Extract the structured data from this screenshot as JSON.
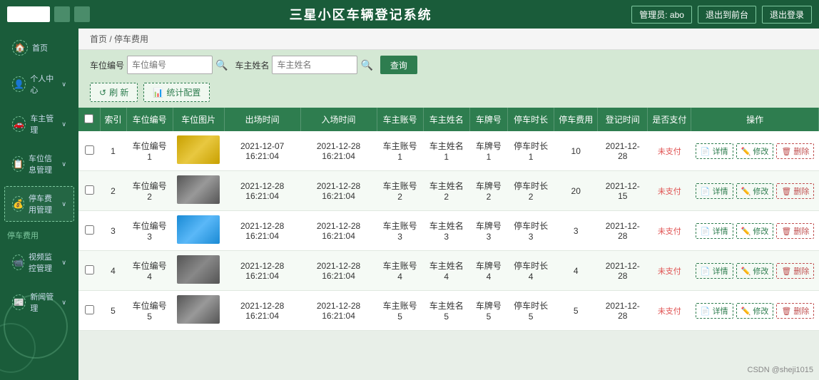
{
  "app": {
    "title": "三星小区车辆登记系统",
    "header": {
      "user_label": "管理员: abo",
      "btn_back": "退出到前台",
      "btn_logout": "退出登录"
    }
  },
  "sidebar": {
    "items": [
      {
        "id": "home",
        "label": "首页",
        "icon": "🏠",
        "arrow": ""
      },
      {
        "id": "personal",
        "label": "个人中心",
        "icon": "👤",
        "arrow": "∨"
      },
      {
        "id": "owner",
        "label": "车主管理",
        "icon": "🚗",
        "arrow": "∨"
      },
      {
        "id": "parking",
        "label": "车位信息管理",
        "icon": "📋",
        "arrow": "∨"
      },
      {
        "id": "parking-fee",
        "label": "停车费用管理",
        "icon": "💰",
        "arrow": "∨"
      }
    ],
    "section": "停车费用",
    "sub_items": [
      {
        "id": "monitor",
        "label": "视频监控管理",
        "icon": "📹",
        "arrow": "∨"
      },
      {
        "id": "notify",
        "label": "新闻管理",
        "icon": "📰",
        "arrow": "∨"
      }
    ]
  },
  "breadcrumb": {
    "home": "首页",
    "current": "停车费用"
  },
  "search": {
    "field1_label": "车位编号",
    "field1_placeholder": "车位编号",
    "field2_label": "车主姓名",
    "field2_placeholder": "车主姓名",
    "btn_label": "查询"
  },
  "toolbar": {
    "btn_refresh": "刷 新",
    "btn_stats": "统计配置"
  },
  "table": {
    "headers": [
      "索引",
      "车位编号",
      "车位图片",
      "出场时间",
      "入场时间",
      "车主账号",
      "车主姓名",
      "车牌号",
      "停车时长",
      "停车费用",
      "登记时间",
      "是否支付",
      "操作"
    ],
    "rows": [
      {
        "index": 1,
        "parking_no": "车位编号1",
        "img_class": "car-img-1",
        "exit_time": "2021-12-07 16:21:04",
        "entry_time": "2021-12-28 16:21:04",
        "owner_account": "车主账号1",
        "owner_name": "车主姓名1",
        "plate": "车牌号1",
        "duration": "停车时长1",
        "fee": 10,
        "reg_time": "2021-12-28",
        "paid": "未支付"
      },
      {
        "index": 2,
        "parking_no": "车位编号2",
        "img_class": "car-img-2",
        "exit_time": "2021-12-28 16:21:04",
        "entry_time": "2021-12-28 16:21:04",
        "owner_account": "车主账号2",
        "owner_name": "车主姓名2",
        "plate": "车牌号2",
        "duration": "停车时长2",
        "fee": 20,
        "reg_time": "2021-12-15",
        "paid": "未支付"
      },
      {
        "index": 3,
        "parking_no": "车位编号3",
        "img_class": "car-img-3",
        "exit_time": "2021-12-28 16:21:04",
        "entry_time": "2021-12-28 16:21:04",
        "owner_account": "车主账号3",
        "owner_name": "车主姓名3",
        "plate": "车牌号3",
        "duration": "停车时长3",
        "fee": 3,
        "reg_time": "2021-12-28",
        "paid": "未支付"
      },
      {
        "index": 4,
        "parking_no": "车位编号4",
        "img_class": "car-img-4",
        "exit_time": "2021-12-28 16:21:04",
        "entry_time": "2021-12-28 16:21:04",
        "owner_account": "车主账号4",
        "owner_name": "车主姓名4",
        "plate": "车牌号4",
        "duration": "停车时长4",
        "fee": 4,
        "reg_time": "2021-12-28",
        "paid": "未支付"
      },
      {
        "index": 5,
        "parking_no": "车位编号5",
        "img_class": "car-img-5",
        "exit_time": "2021-12-28 16:21:04",
        "entry_time": "2021-12-28 16:21:04",
        "owner_account": "车主账号5",
        "owner_name": "车主姓名5",
        "plate": "车牌号5",
        "duration": "停车时长5",
        "fee": 5,
        "reg_time": "2021-12-28",
        "paid": "未支付"
      }
    ],
    "actions": {
      "detail": "详情",
      "edit": "修改",
      "delete": "删除"
    }
  },
  "watermark": "CSDN @sheji1015"
}
